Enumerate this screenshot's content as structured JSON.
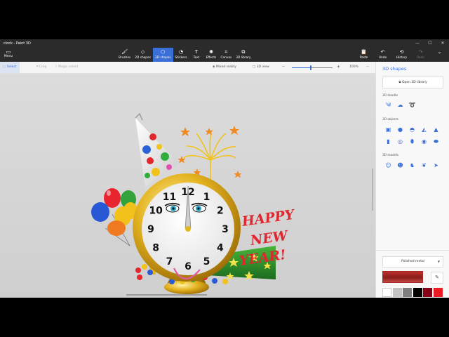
{
  "window": {
    "title": "clock - Paint 3D",
    "minimize_glyph": "—",
    "maximize_glyph": "☐",
    "close_glyph": "✕"
  },
  "ribbon": {
    "menu_label": "Menu",
    "tools": [
      {
        "label": "Brushes",
        "icon": "brush-icon",
        "glyph": "🖌"
      },
      {
        "label": "2D shapes",
        "icon": "2d-shapes-icon",
        "glyph": "◇"
      },
      {
        "label": "3D shapes",
        "icon": "3d-shapes-icon",
        "glyph": "⬡"
      },
      {
        "label": "Stickers",
        "icon": "sticker-icon",
        "glyph": "◔"
      },
      {
        "label": "Text",
        "icon": "text-icon",
        "glyph": "T"
      },
      {
        "label": "Effects",
        "icon": "effects-icon",
        "glyph": "✺"
      },
      {
        "label": "Canvas",
        "icon": "canvas-icon",
        "glyph": "⌗"
      },
      {
        "label": "3D library",
        "icon": "3d-library-icon",
        "glyph": "⧉"
      }
    ],
    "active_tool": "3D shapes",
    "right_tools": [
      {
        "label": "Paste",
        "icon": "paste-icon",
        "glyph": "📋"
      },
      {
        "label": "Undo",
        "icon": "undo-icon",
        "glyph": "↶"
      },
      {
        "label": "History",
        "icon": "history-icon",
        "glyph": "⟲"
      },
      {
        "label": "Redo",
        "icon": "redo-icon",
        "glyph": "↷"
      }
    ],
    "more_glyph": "⌄"
  },
  "toolbar": {
    "select": "Select",
    "crop": "Crop",
    "magic_select": "Magic select",
    "mixed_reality": "Mixed reality",
    "view_3d": "3D view",
    "zoom_out": "—",
    "zoom_in": "+",
    "zoom": "100%",
    "zoom_level": 0.47,
    "more": "···"
  },
  "canvas": {
    "greeting": [
      "HAPPY",
      "NEW",
      "YEAR!"
    ],
    "clock_numbers": [
      "12",
      "1",
      "2",
      "3",
      "4",
      "5",
      "6",
      "7",
      "8",
      "9",
      "10",
      "11"
    ]
  },
  "panel": {
    "title": "3D shapes",
    "open_library": "Open 3D library",
    "doodle_label": "3D doodle",
    "objects_label": "3D objects",
    "models_label": "3D models",
    "doodle_icons": [
      "sharp-doodle-icon",
      "soft-doodle-icon",
      "tube-doodle-icon"
    ],
    "object_icons": [
      "cube-icon",
      "sphere-icon",
      "hemisphere-icon",
      "cone-icon",
      "pyramid-icon",
      "cylinder-icon",
      "tube-icon",
      "capsule-icon",
      "donut-icon",
      "pill-icon"
    ],
    "model_icons": [
      "man-icon",
      "woman-icon",
      "dog-icon",
      "cat-icon",
      "fish-icon"
    ],
    "material": "Polished metal",
    "selected_color": "#a82926",
    "palette": [
      "#ffffff",
      "#c3c3c3",
      "#7f7f7f",
      "#000000",
      "#880015",
      "#ed1c24",
      "#ff7f27",
      "#ffc90e",
      "#fff200",
      "#efe4b0",
      "#22b14c",
      "#b5e61d",
      "#99d9ea",
      "#00a2e8",
      "#3f48cc",
      "#a349a4",
      "#c8bfe7",
      "#b97a57",
      "#e6222c",
      "#e8c8c3",
      "#6b2a16",
      "#1a5d2a",
      "#0b4a1c",
      "#2f8a36"
    ]
  }
}
